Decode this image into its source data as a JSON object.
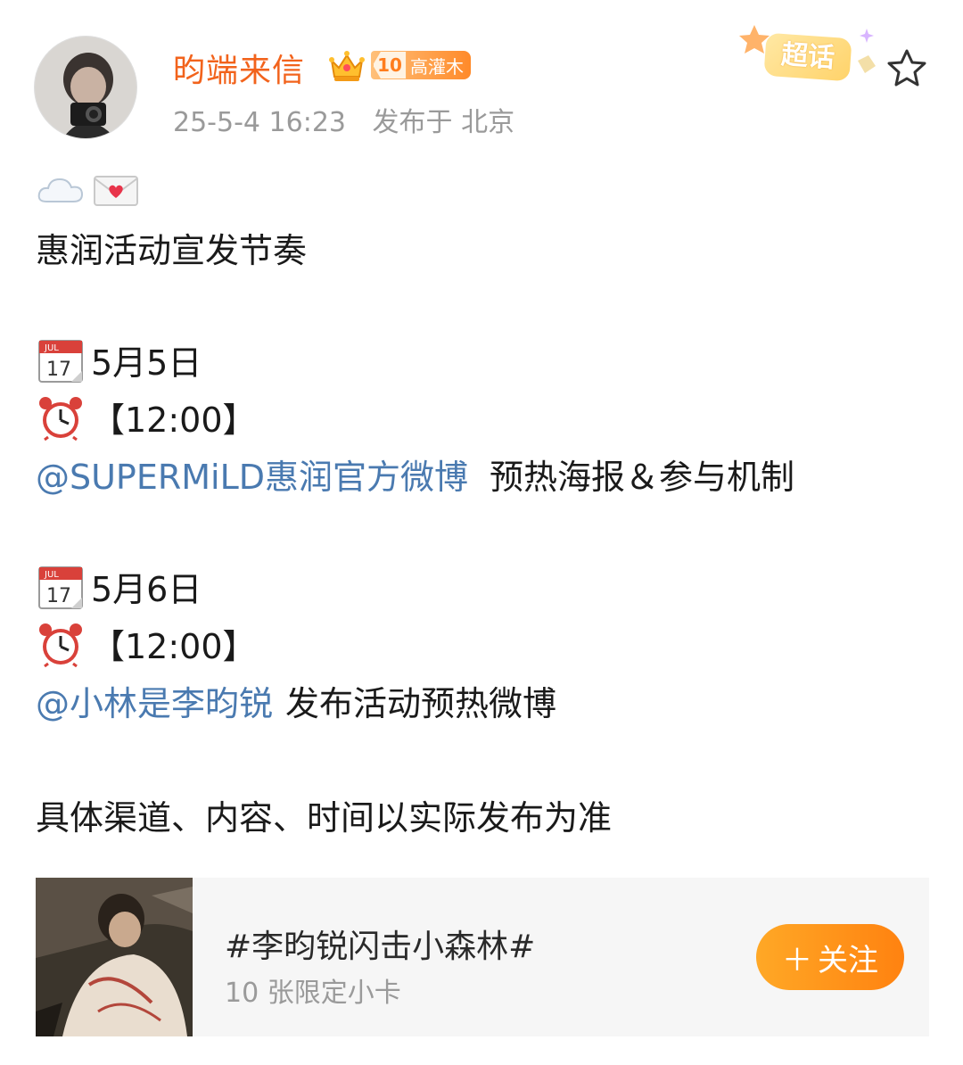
{
  "post": {
    "username": "昀端来信",
    "level_number": "10",
    "level_title": "高灌木",
    "timestamp": "25-5-4 16:23",
    "location": "发布于 北京",
    "supertopic_label": "超话"
  },
  "content": {
    "intro": "惠润活动宣发节奏",
    "item1_date": "5月5日",
    "item1_time": "【12:00】",
    "item1_mention": "@SUPERMiLD惠润官方微博",
    "item1_text": "预热海报＆参与机制",
    "item2_date": "5月6日",
    "item2_time": "【12:00】",
    "item2_mention": "@小林是李昀锐",
    "item2_text": "发布活动预热微博",
    "footer": "具体渠道、内容、时间以实际发布为准"
  },
  "topic_card": {
    "title": "#李昀锐闪击小森林#",
    "subtitle": "10 张限定小卡",
    "follow_label": "关注",
    "follow_plus": "＋"
  },
  "calendar_icon": {
    "month": "JUL",
    "day": "17"
  },
  "colors": {
    "username": "#f2631c",
    "mention": "#4a7ab0",
    "follow_button": "#ff9a1e",
    "meta": "#9a9a9a"
  }
}
